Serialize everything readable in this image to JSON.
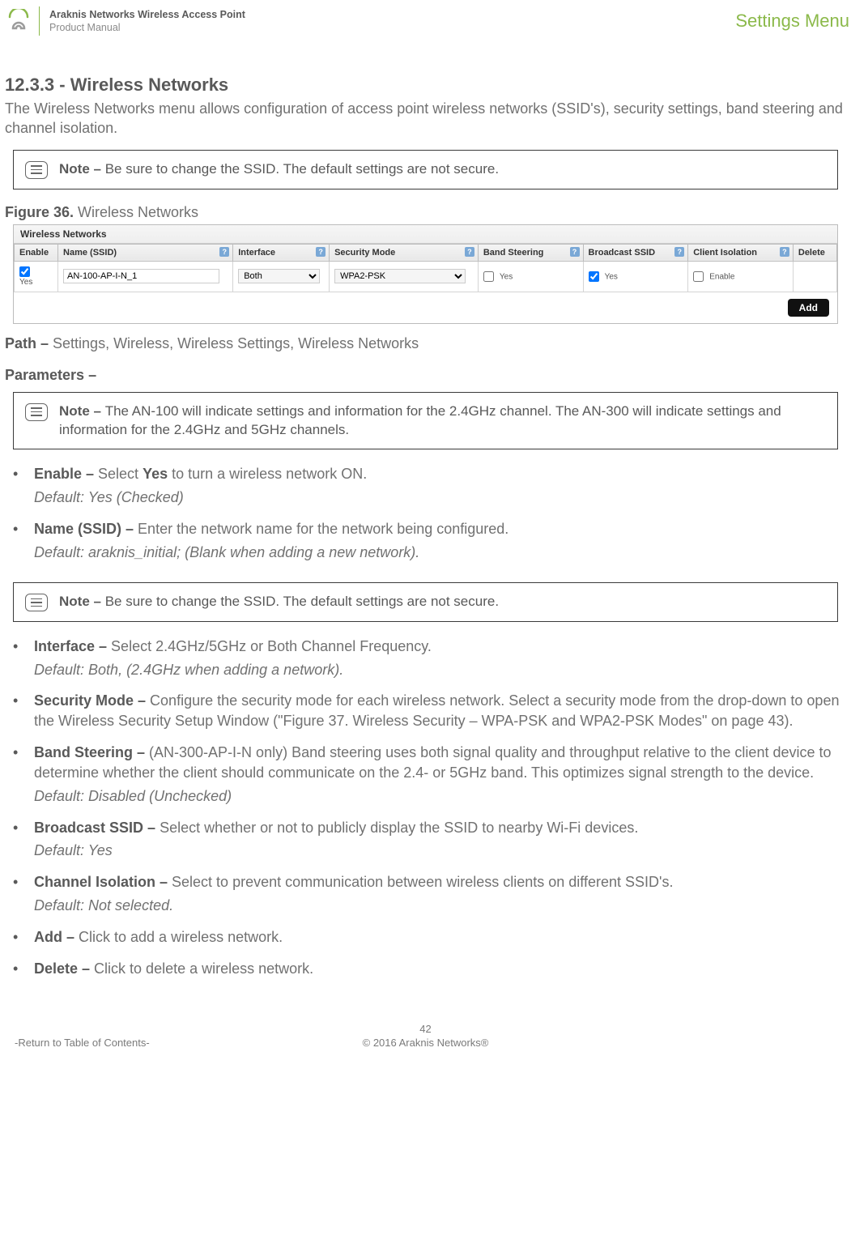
{
  "header": {
    "product_line": "Araknis Networks Wireless Access Point",
    "subtitle": "Product Manual",
    "right_link": "Settings Menu"
  },
  "section": {
    "number_title": "12.3.3 - Wireless Networks",
    "intro": "The Wireless Networks menu allows configuration of access point wireless networks (SSID's), security settings, band steering and channel isolation."
  },
  "note1": {
    "label": "Note – ",
    "text": "Be sure to change the SSID. The default settings are not secure."
  },
  "figure": {
    "label": "Figure 36.",
    "caption": " Wireless Networks"
  },
  "ui": {
    "panel_title": "Wireless Networks",
    "headers": {
      "enable": "Enable",
      "name": "Name (SSID)",
      "interface": "Interface",
      "security": "Security Mode",
      "band": "Band Steering",
      "broadcast": "Broadcast SSID",
      "isolation": "Client Isolation",
      "delete": "Delete"
    },
    "row": {
      "enable_label": "Yes",
      "ssid": "AN-100-AP-I-N_1",
      "interface": "Both",
      "security": "WPA2-PSK",
      "band_label": "Yes",
      "broadcast_label": "Yes",
      "isolation_label": "Enable"
    },
    "add_button": "Add"
  },
  "path": {
    "label": "Path – ",
    "value": "Settings, Wireless, Wireless Settings, Wireless Networks"
  },
  "params_heading": "Parameters –",
  "note2": {
    "label": "Note – ",
    "text": "The AN-100 will indicate settings and information for the 2.4GHz channel. The AN-300 will indicate settings and information for the 2.4GHz and 5GHz channels."
  },
  "params": {
    "enable": {
      "label": "Enable – ",
      "text_pre": "Select ",
      "yes": "Yes",
      "text_post": " to turn a wireless network ON.",
      "default": "Default: Yes (Checked)"
    },
    "name": {
      "label": "Name (SSID) – ",
      "text": "Enter the network name for the network being configured.",
      "default": "Default: araknis_initial; (Blank when adding a new network)."
    },
    "note3": {
      "label": "Note – ",
      "text": "Be sure to change the SSID. The default settings are not secure."
    },
    "interface": {
      "label": "Interface – ",
      "text": "Select 2.4GHz/5GHz or Both Channel Frequency.",
      "default": "Default: Both, (2.4GHz when adding a network)."
    },
    "security": {
      "label": "Security Mode – ",
      "text": "Configure the security mode for each wireless network. Select a security mode from the drop-down to open the Wireless Security Setup Window (\"Figure 37. Wireless Security – WPA-PSK and WPA2-PSK Modes\" on page 43)."
    },
    "band": {
      "label": "Band Steering – ",
      "text": "(AN-300-AP-I-N only) Band steering uses both signal quality and throughput relative to the client device to determine whether the client  should communicate on the 2.4- or 5GHz band. This optimizes signal strength to the device.",
      "default": "Default: Disabled (Unchecked)"
    },
    "broadcast": {
      "label": "Broadcast SSID – ",
      "text": "Select whether or not to publicly display the SSID to nearby Wi-Fi devices.",
      "default": "Default: Yes"
    },
    "isolation": {
      "label": "Channel Isolation – ",
      "text": "Select to prevent communication between wireless clients on different SSID's.",
      "default": "Default: Not selected."
    },
    "add": {
      "label": "Add – ",
      "text": "Click to add a wireless network."
    },
    "delete": {
      "label": "Delete – ",
      "text": "Click to delete a wireless network."
    }
  },
  "footer": {
    "page": "42",
    "copyright": "© 2016 Araknis Networks®",
    "toc": "-Return to Table of Contents-"
  }
}
